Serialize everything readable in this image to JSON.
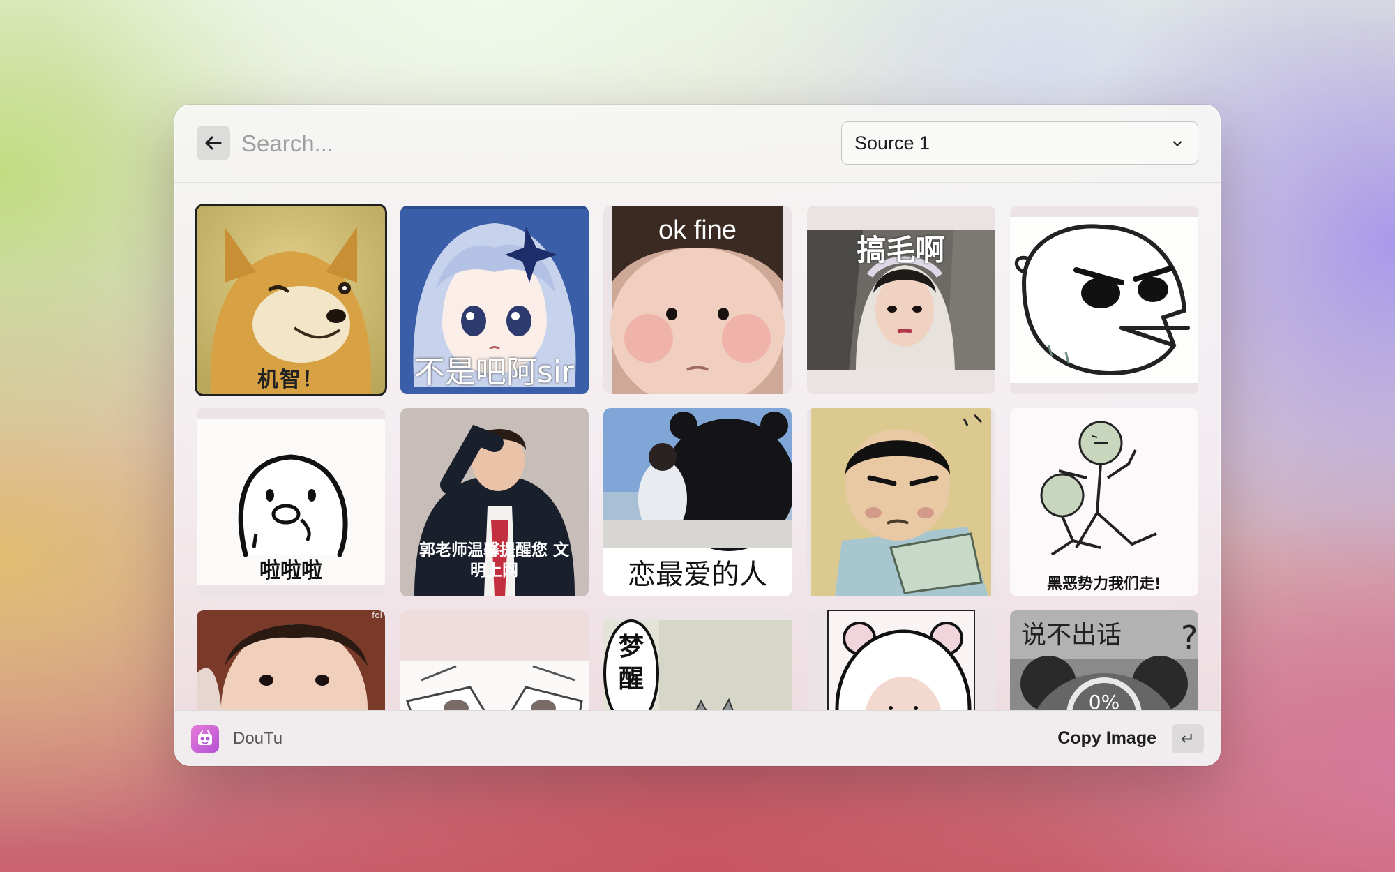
{
  "search": {
    "placeholder": "Search..."
  },
  "source_select": {
    "value": "Source 1"
  },
  "grid": {
    "items": [
      {
        "caption": "机智！",
        "name": "doge-wink"
      },
      {
        "caption": "不是吧阿sir",
        "name": "anime-girl"
      },
      {
        "caption": "ok fine",
        "name": "chubby-baby"
      },
      {
        "caption": "搞毛啊",
        "name": "drama-lady"
      },
      {
        "caption": "",
        "name": "angry-bird-sketch"
      },
      {
        "caption": "啦啦啦",
        "name": "blob-chick"
      },
      {
        "caption": "郭老师温馨提醒您 文明上网",
        "name": "saluting-woman"
      },
      {
        "caption": "恋最爱的人",
        "name": "kumamon-hug"
      },
      {
        "caption": "",
        "name": "cartoon-boy-desk"
      },
      {
        "caption": "黑恶势力我们走!",
        "name": "stick-men-running"
      },
      {
        "caption": "",
        "name": "baby-face"
      },
      {
        "caption": "",
        "name": "anime-eyes"
      },
      {
        "caption": "梦醒",
        "name": "comic-cat"
      },
      {
        "caption": "",
        "name": "bear-hood-face"
      },
      {
        "caption": "说不出话",
        "name": "panda-loading"
      }
    ],
    "loading_percent": "0%",
    "watermark": "fol"
  },
  "footer": {
    "app_name": "DouTu",
    "action_label": "Copy Image",
    "enter_key": "↵"
  },
  "icons": {
    "back": "arrow-left-icon",
    "dropdown": "chevron-down-icon",
    "app": "doutu-app-icon",
    "enter": "enter-key-icon"
  }
}
